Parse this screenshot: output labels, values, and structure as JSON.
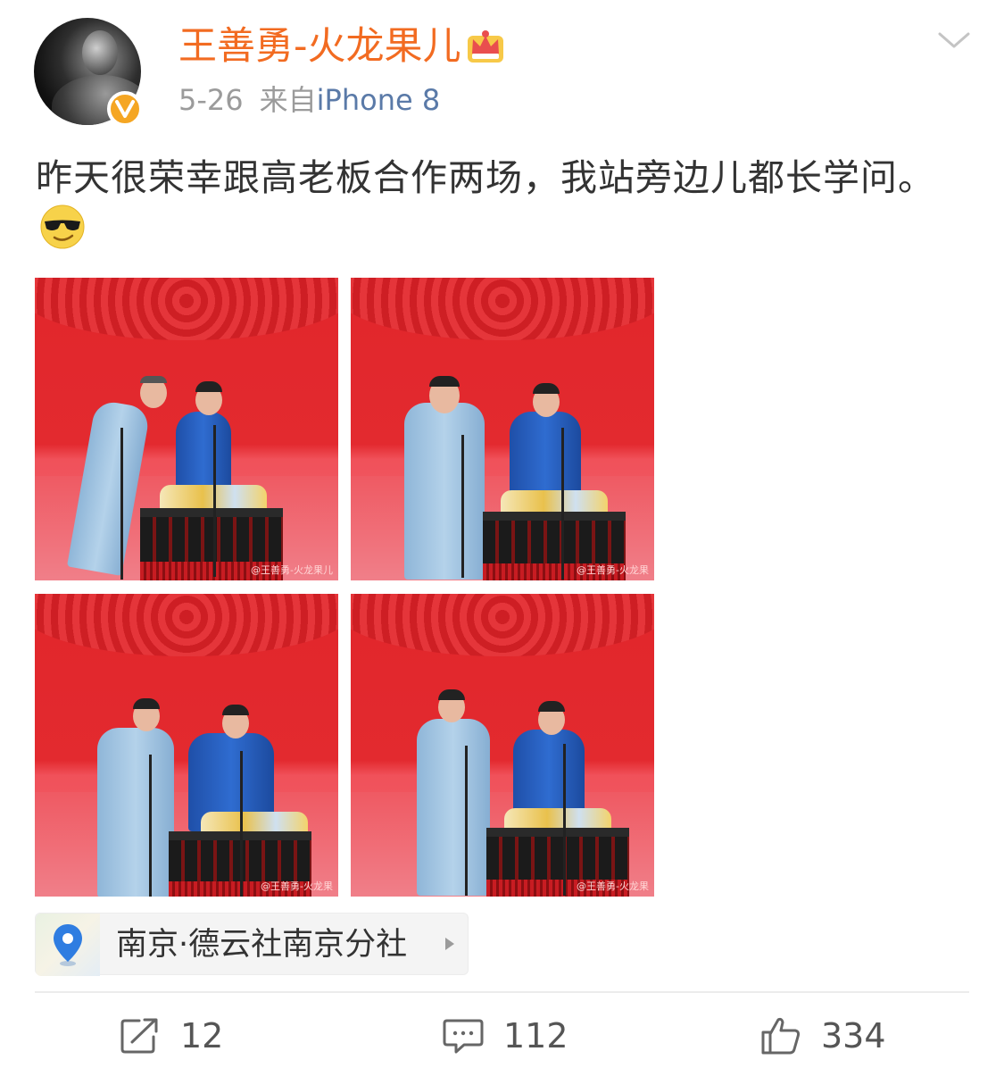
{
  "user": {
    "name": "王善勇-火龙果儿",
    "verified": true,
    "verify_badge_color": "#f5a623",
    "member_icon": "crown-icon",
    "name_color": "#f26b21"
  },
  "meta": {
    "date": "5-26",
    "source_prefix": "来自",
    "device": "iPhone 8"
  },
  "post": {
    "text": "昨天很荣幸跟高老板合作两场，我站旁边儿都长学问。",
    "emoji": "sunglasses-emoji"
  },
  "photos": [
    {
      "watermark": "@王善勇-火龙果儿"
    },
    {
      "watermark": "@王善勇-火龙果"
    },
    {
      "watermark": "@王善勇-火龙果"
    },
    {
      "watermark": "@王善勇-火龙果"
    }
  ],
  "location": {
    "label": "南京·德云社南京分社"
  },
  "actions": {
    "repost_count": "12",
    "comment_count": "112",
    "like_count": "334"
  }
}
